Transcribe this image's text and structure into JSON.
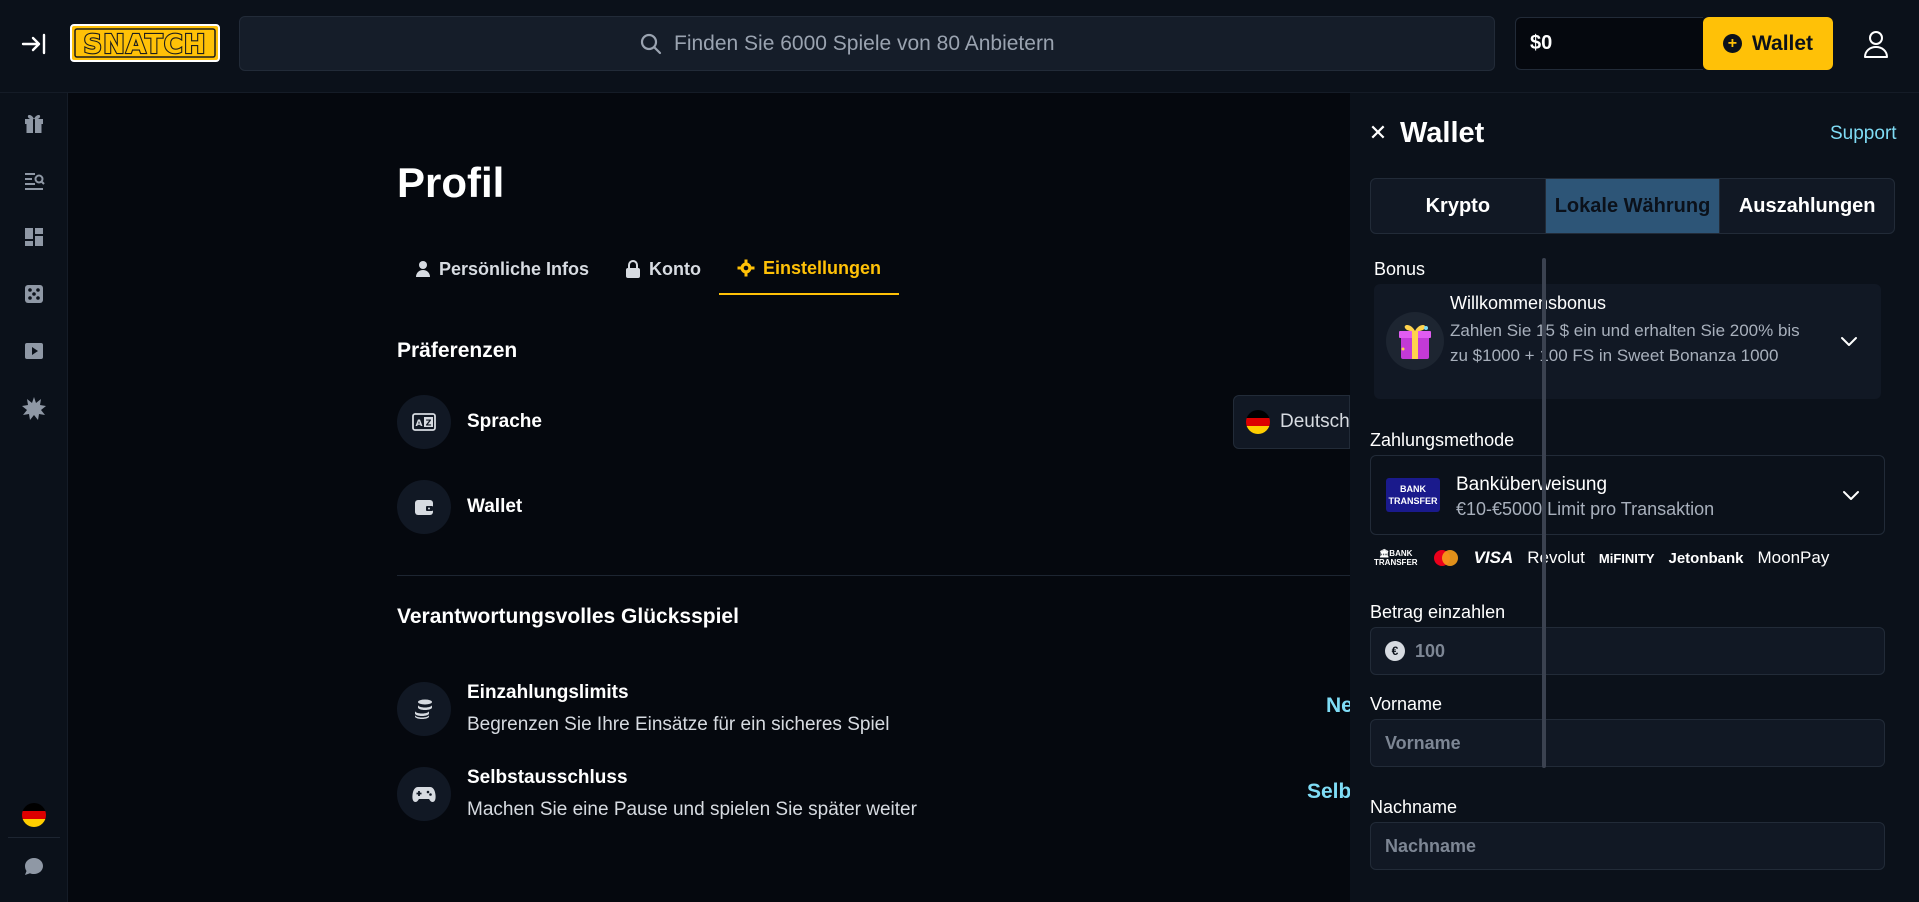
{
  "header": {
    "logo_text": "SNATCH",
    "search_placeholder": "Finden Sie 6000 Spiele von 80 Anbietern",
    "balance": "$0",
    "wallet_button": "Wallet"
  },
  "sidebar": {
    "icons": [
      "gift-icon",
      "search-list-icon",
      "dashboard-icon",
      "dice-icon",
      "play-icon",
      "burst-icon"
    ],
    "bottom": [
      "flag-de-icon",
      "chat-icon"
    ]
  },
  "profile": {
    "title": "Profil",
    "tabs": [
      {
        "label": "Persönliche Infos",
        "icon": "user-icon"
      },
      {
        "label": "Konto",
        "icon": "lock-icon"
      },
      {
        "label": "Einstellungen",
        "icon": "gear-icon",
        "active": true
      }
    ],
    "preferences_title": "Präferenzen",
    "language_label": "Sprache",
    "language_value": "Deutsch",
    "wallet_label": "Wallet",
    "responsible_title": "Verantwortungsvolles Glücksspiel",
    "deposit_limits_label": "Einzahlungslimits",
    "deposit_limits_desc": "Begrenzen Sie Ihre Einsätze für ein sicheres Spiel",
    "deposit_limits_action": "Ne",
    "self_exclusion_label": "Selbstausschluss",
    "self_exclusion_desc": "Machen Sie eine Pause und spielen Sie später weiter",
    "self_exclusion_action": "Selb"
  },
  "wallet_panel": {
    "title": "Wallet",
    "support": "Support",
    "tabs": [
      "Krypto",
      "Lokale Währung",
      "Auszahlungen"
    ],
    "active_tab": 1,
    "bonus_label": "Bonus",
    "bonus_title": "Willkommensbonus",
    "bonus_desc": "Zahlen Sie 15 $ ein und erhalten Sie 200% bis zu $1000 + 100 FS in Sweet Bonanza 1000",
    "method_label": "Zahlungsmethode",
    "method_title": "Banküberweisung",
    "method_desc": "€10-€5000 Limit pro Transaktion",
    "bank_logo_text": "BANK TRANSFER",
    "payment_logos": [
      "VISA",
      "Revolut",
      "MiFINITY",
      "Jetonbank",
      "MoonPay"
    ],
    "amount_label": "Betrag einzahlen",
    "amount_placeholder": "100",
    "firstname_label": "Vorname",
    "firstname_placeholder": "Vorname",
    "lastname_label": "Nachname",
    "lastname_placeholder": "Nachname"
  },
  "colors": {
    "accent": "#ffc107",
    "link": "#7fdcf5",
    "active_tab_bg": "#2d5577"
  }
}
